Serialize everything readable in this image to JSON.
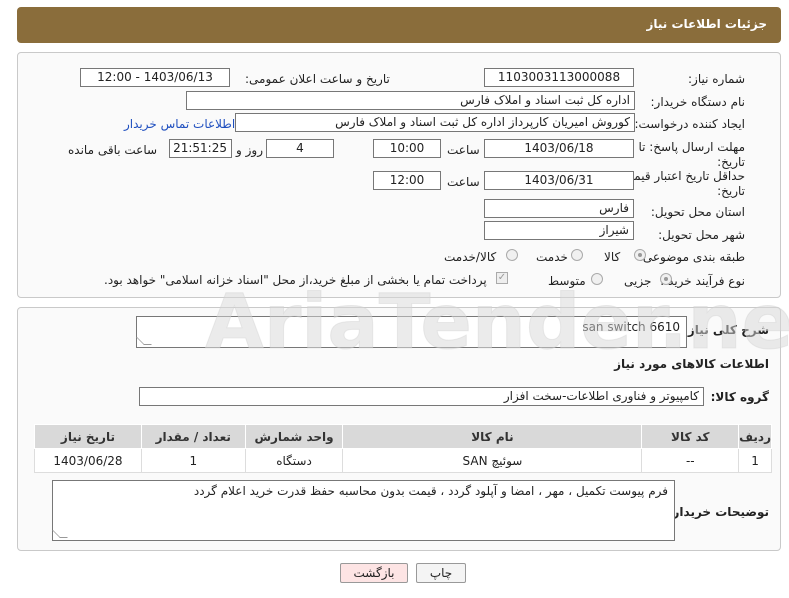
{
  "header": {
    "title": "جزئیات اطلاعات نیاز"
  },
  "info": {
    "need_number_label": "شماره نیاز:",
    "need_number": "1103003113000088",
    "announce_label": "تاریخ و ساعت اعلان عمومی:",
    "announce_value": "1403/06/13 - 12:00",
    "buyer_org_label": "نام دستگاه خریدار:",
    "buyer_org": "اداره کل ثبت اسناد و املاک فارس",
    "requester_label": "ایجاد کننده درخواست:",
    "requester": "کوروش امیریان کارپرداز اداره کل ثبت اسناد و املاک فارس",
    "contact_link": "اطلاعات تماس خریدار",
    "deadline_label": "مهلت ارسال پاسخ: تا",
    "deadline_label2": "تاریخ:",
    "deadline_date": "1403/06/18",
    "time_label": "ساعت",
    "deadline_time": "10:00",
    "days_value": "4",
    "days_label": "روز و",
    "remaining_time": "21:51:25",
    "remaining_label": "ساعت باقی مانده",
    "validity_label": "حداقل تاریخ اعتبار قیمت: تا",
    "validity_label2": "تاریخ:",
    "validity_date": "1403/06/31",
    "validity_time": "12:00",
    "province_label": "استان محل تحویل:",
    "province": "فارس",
    "city_label": "شهر محل تحویل:",
    "city": "شیراز",
    "category_label": "طبقه بندی موضوعی:",
    "category_options": [
      "کالا",
      "خدمت",
      "کالا/خدمت"
    ],
    "process_label": "نوع فرآیند خرید :",
    "process_options": [
      "جزیی",
      "متوسط"
    ],
    "payment_note": "پرداخت تمام یا بخشی از مبلغ خرید،از محل \"اسناد خزانه اسلامی\" خواهد بود."
  },
  "details": {
    "description_label": "شرح کلی نیاز:",
    "description": "san switch 6610",
    "goods_info_title": "اطلاعات کالاهای مورد نیاز",
    "group_label": "گروه کالا:",
    "group_value": "کامپیوتر و فناوری اطلاعات-سخت افزار",
    "table": {
      "headers": [
        "ردیف",
        "کد کالا",
        "نام کالا",
        "واحد شمارش",
        "تعداد / مقدار",
        "تاریخ نیاز"
      ],
      "rows": [
        [
          "1",
          "--",
          "سوئیچ SAN",
          "دستگاه",
          "1",
          "1403/06/28"
        ]
      ]
    },
    "buyer_notes_label": "توضیحات خریدار:",
    "buyer_notes": "فرم پیوست تکمیل ، مهر ، امضا و آپلود گردد ، قیمت بدون محاسبه حفظ قدرت خرید اعلام گردد"
  },
  "buttons": {
    "print": "چاپ",
    "back": "بازگشت"
  },
  "watermark": {
    "text": "AriaTender.net"
  },
  "colors": {
    "header": "#8a6d3b",
    "link": "#1f4fbf",
    "back_button": "#fde4e4"
  }
}
